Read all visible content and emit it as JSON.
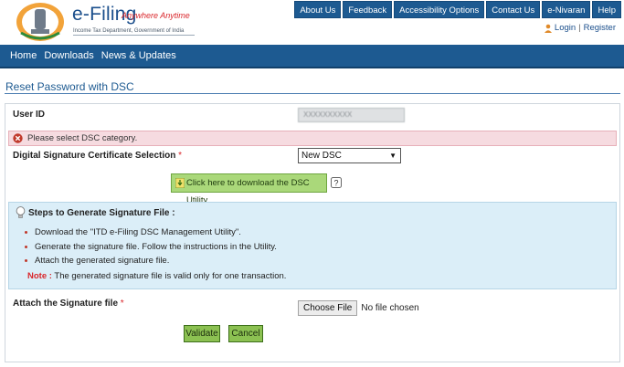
{
  "header": {
    "brand_title": "e-Filing",
    "brand_tagline": "Anywhere Anytime",
    "brand_subtitle": "Income Tax Department, Government of India",
    "top_nav": [
      "About Us",
      "Feedback",
      "Accessibility Options",
      "Contact Us",
      "e-Nivaran",
      "Help"
    ],
    "login_label": "Login",
    "auth_separator": "|",
    "register_label": "Register"
  },
  "main_nav": [
    "Home",
    "Downloads",
    "News & Updates"
  ],
  "form": {
    "title": "Reset Password with DSC",
    "user_id_label": "User ID",
    "user_id_value": "XXXXXXXXXX",
    "error_message": "Please select DSC category.",
    "dsc_selection_label": "Digital Signature Certificate Selection",
    "required_mark": "*",
    "dsc_selected": "New DSC",
    "download_button": "Click here to download the DSC Utility",
    "steps_title": "Steps to Generate Signature File :",
    "steps": [
      "Download the \"ITD e-Filing DSC Management Utility\".",
      "Generate the signature file. Follow the instructions in the Utility.",
      "Attach the generated signature file."
    ],
    "note_label": "Note :",
    "note_text": "The generated signature file is valid only for one transaction.",
    "attach_label": "Attach the Signature file",
    "choose_file_button": "Choose File",
    "no_file_text": "No file chosen",
    "validate_button": "Validate",
    "cancel_button": "Cancel"
  },
  "colors": {
    "nav_blue": "#1d5a91",
    "error_bg": "#f6dbe0",
    "info_bg": "#dbeef8",
    "button_green": "#8cc152",
    "accent_red": "#d9262b"
  },
  "icons": [
    "emblem-logo",
    "user-icon",
    "error-icon",
    "download-icon",
    "help-icon",
    "bulb-icon",
    "select-caret-icon"
  ]
}
